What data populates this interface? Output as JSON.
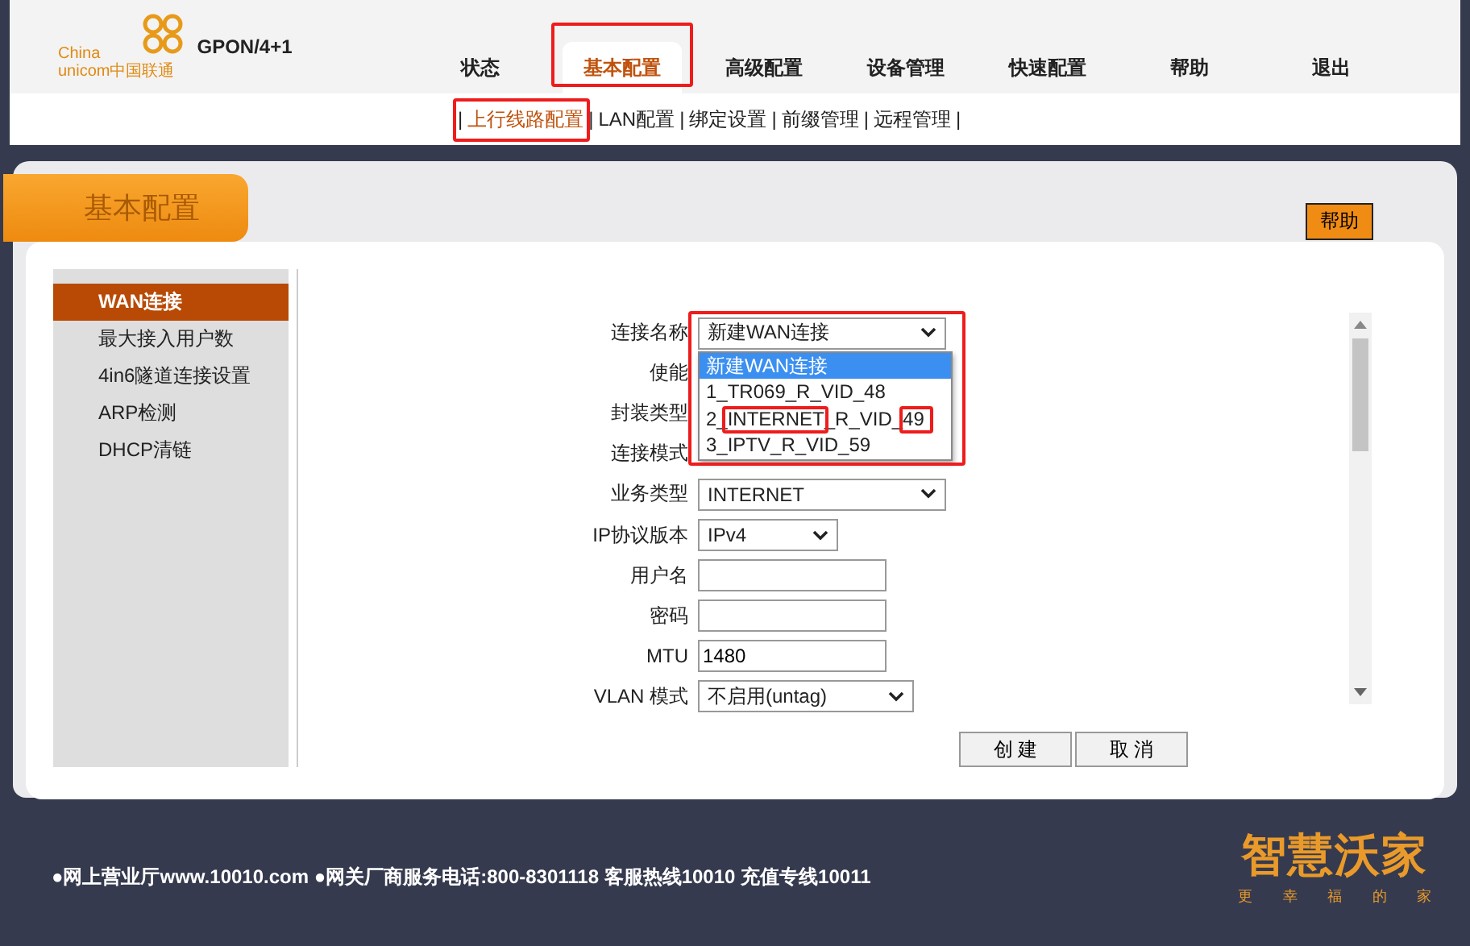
{
  "header": {
    "logo_line1": "China",
    "logo_line2": "unicom中国联通",
    "model": "GPON/4+1",
    "tabs": [
      {
        "label": "状态",
        "selected": false
      },
      {
        "label": "基本配置",
        "selected": true
      },
      {
        "label": "高级配置",
        "selected": false
      },
      {
        "label": "设备管理",
        "selected": false
      },
      {
        "label": "快速配置",
        "selected": false
      },
      {
        "label": "帮助",
        "selected": false
      },
      {
        "label": "退出",
        "selected": false
      }
    ]
  },
  "subnav": {
    "separator": "|",
    "items": [
      {
        "label": "上行线路配置",
        "selected": true
      },
      {
        "label": "LAN配置",
        "selected": false
      },
      {
        "label": "绑定设置",
        "selected": false
      },
      {
        "label": "前缀管理",
        "selected": false
      },
      {
        "label": "远程管理",
        "selected": false
      }
    ]
  },
  "page_title": "基本配置",
  "help_button": "帮助",
  "sidebar": {
    "items": [
      {
        "label": "WAN连接",
        "selected": true
      },
      {
        "label": "最大接入用户数",
        "selected": false
      },
      {
        "label": "4in6隧道连接设置",
        "selected": false
      },
      {
        "label": "ARP检测",
        "selected": false
      },
      {
        "label": "DHCP清链",
        "selected": false
      }
    ]
  },
  "form": {
    "rows": [
      {
        "label": "连接名称",
        "kind": "select",
        "value": "新建WAN连接"
      },
      {
        "label": "使能",
        "kind": "covered"
      },
      {
        "label": "封装类型",
        "kind": "covered"
      },
      {
        "label": "连接模式",
        "kind": "covered"
      },
      {
        "label": "业务类型",
        "kind": "select",
        "value": "INTERNET"
      },
      {
        "label": "IP协议版本",
        "kind": "select-short",
        "value": "IPv4"
      },
      {
        "label": "用户名",
        "kind": "text",
        "value": ""
      },
      {
        "label": "密码",
        "kind": "text",
        "value": ""
      },
      {
        "label": "MTU",
        "kind": "text",
        "value": "1480"
      },
      {
        "label": "VLAN 模式",
        "kind": "select-mid",
        "value": "不启用(untag)"
      }
    ],
    "dropdown": [
      {
        "label": "新建WAN连接",
        "selected": true
      },
      {
        "label": "1_TR069_R_VID_48",
        "selected": false
      },
      {
        "label": "2_INTERNET_R_VID_49",
        "selected": false
      },
      {
        "label": "3_IPTV_R_VID_59",
        "selected": false
      }
    ]
  },
  "buttons": [
    {
      "label": "创 建"
    },
    {
      "label": "取 消"
    }
  ],
  "footer": {
    "text": "●网上营业厅www.10010.com ●网关厂商服务电话:800-8301118 客服热线10010 充值专线10011",
    "brand": "智慧沃家",
    "slogan": [
      "更",
      "幸",
      "福",
      "的",
      "家"
    ]
  }
}
